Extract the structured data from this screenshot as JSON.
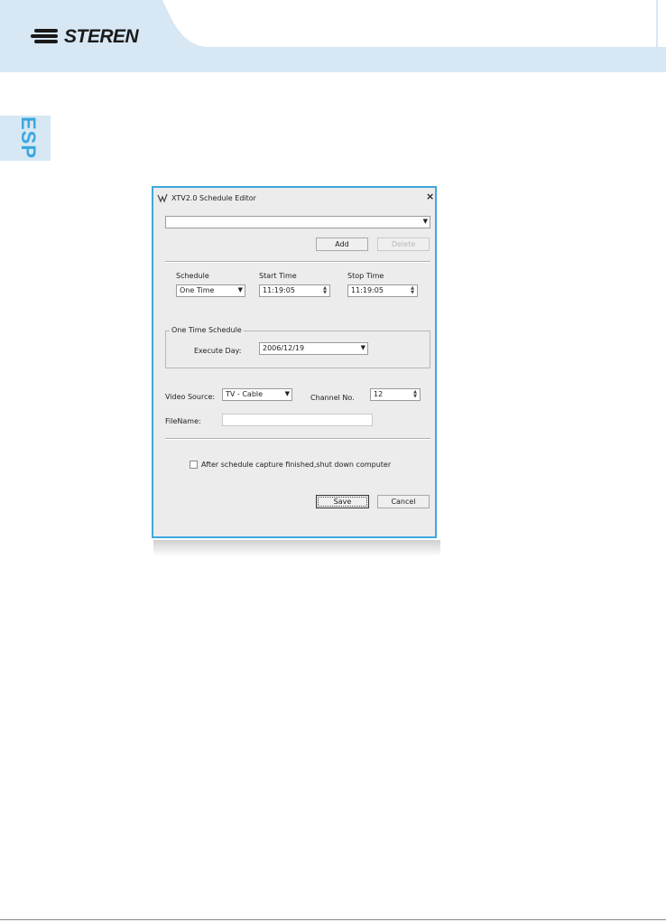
{
  "brand": {
    "logo_text": "STEREN",
    "accent_color": "#3ba7e0",
    "header_color": "#d7e7f3"
  },
  "side_tab": {
    "label": "ESP"
  },
  "dialog": {
    "title": "XTV2.0 Schedule Editor",
    "title_icon": "app-icon",
    "close_glyph": "×",
    "schedule_list": {
      "value": ""
    },
    "add_label": "Add",
    "delete_label": "Delete",
    "schedule": {
      "label": "Schedule",
      "value": "One Time"
    },
    "start_time": {
      "label": "Start Time",
      "value": "11:19:05"
    },
    "stop_time": {
      "label": "Stop Time",
      "value": "11:19:05"
    },
    "one_time_group": {
      "legend": "One Time Schedule",
      "execute_day_label": "Execute Day:",
      "execute_day_value": "2006/12/19"
    },
    "video_source": {
      "label": "Video Source:",
      "value": "TV - Cable"
    },
    "channel": {
      "label": "Channel No.",
      "value": "12"
    },
    "filename": {
      "label": "FileName:",
      "value": ""
    },
    "shutdown_checkbox": {
      "label": "After schedule capture finished,shut down computer",
      "checked": false
    },
    "save_label": "Save",
    "cancel_label": "Cancel"
  }
}
